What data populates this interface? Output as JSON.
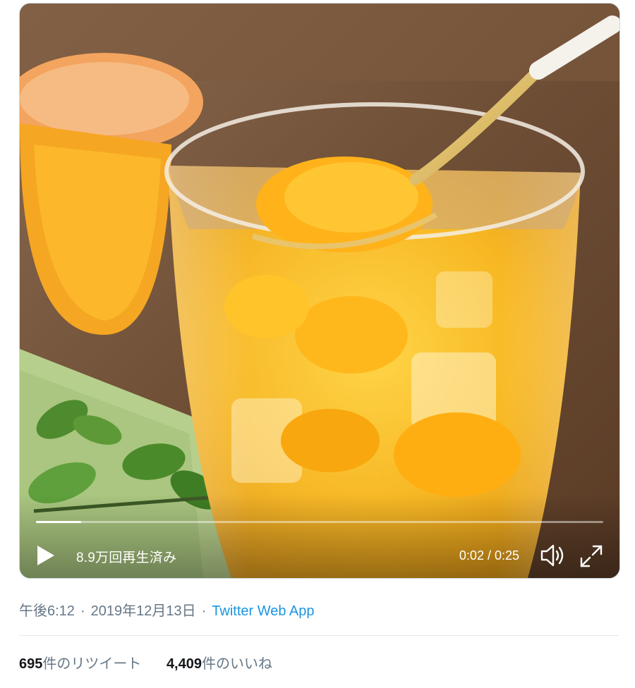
{
  "video": {
    "description": "Glass of orange jelly with mandarin segments and ice, gold spoon, orange container and green leaves in background",
    "views_label": "8.9万回再生済み",
    "time_label": "0:02 / 0:25",
    "progress_fraction": 0.08,
    "play_icon": "play-icon",
    "volume_icon": "volume-icon",
    "fullscreen_icon": "fullscreen-icon"
  },
  "meta": {
    "time": "午後6:12",
    "separator": "·",
    "date": "2019年12月13日",
    "source": "Twitter Web App"
  },
  "stats": {
    "retweets_count": "695",
    "retweets_label": "件のリツイート",
    "likes_count": "4,409",
    "likes_label": "件のいいね"
  },
  "colors": {
    "link": "#1b95e0",
    "muted": "#657786",
    "text": "#14171a"
  }
}
